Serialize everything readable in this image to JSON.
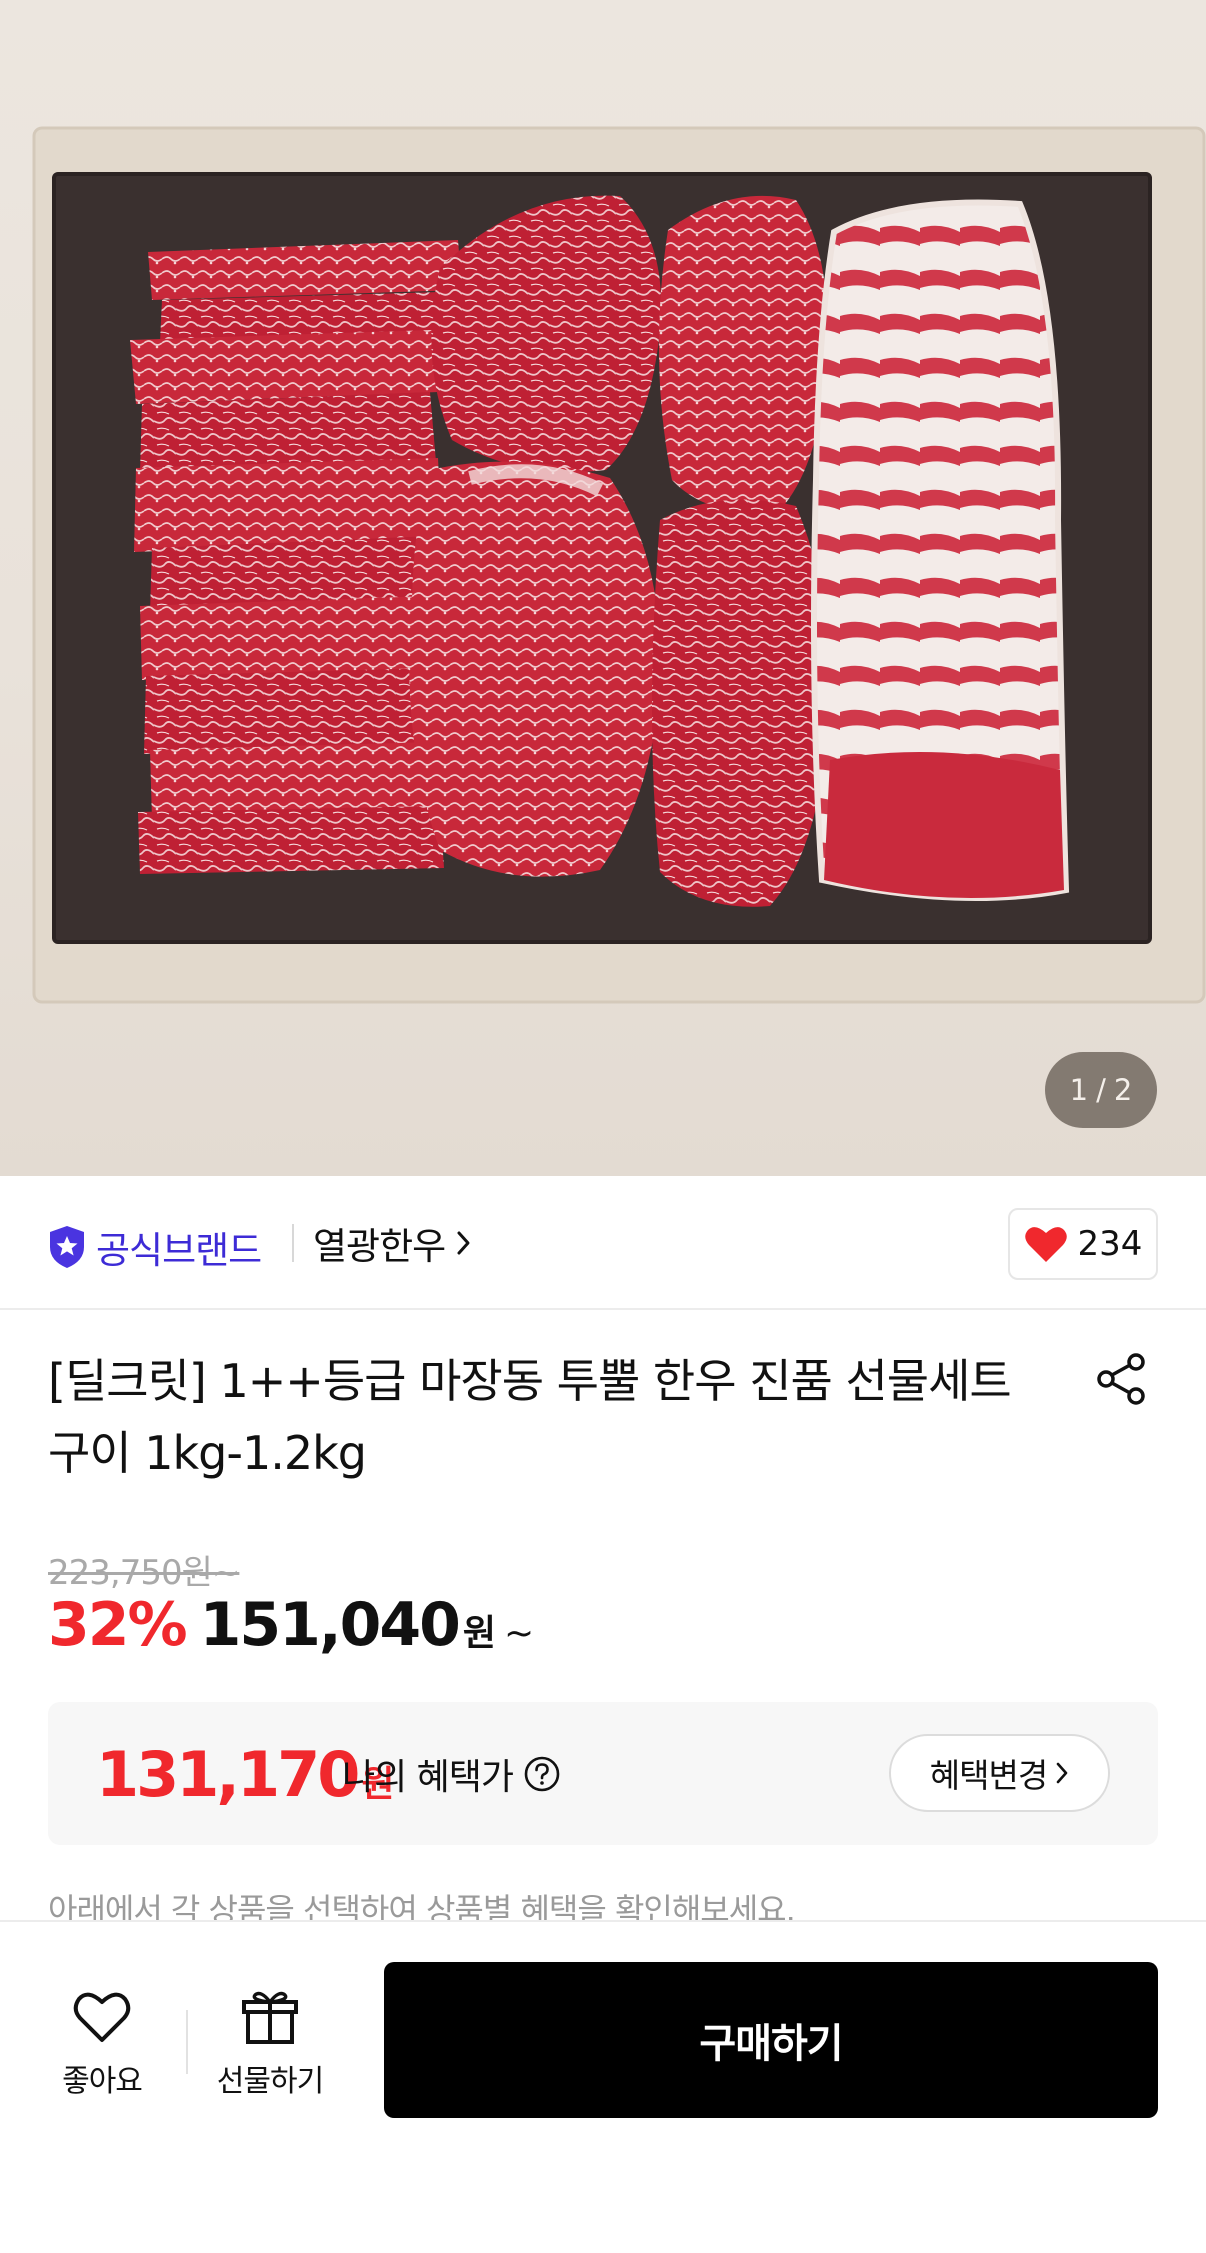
{
  "gallery": {
    "current_page": "1",
    "separator": "/",
    "total_pages": "2"
  },
  "brand": {
    "badge_label": "공식브랜드",
    "store_name": "열광한우",
    "like_count": "234"
  },
  "product": {
    "title_line1": "[딜크릿] 1++등급 마장동 투뿔 한우 진품 선물세트",
    "title_line2": "구이 1kg-1.2kg",
    "original_price": "223,750원~",
    "discount_rate": "32%",
    "sale_price": "151,040",
    "currency": "원",
    "price_suffix": "~"
  },
  "benefit": {
    "price": "131,170",
    "currency": "원",
    "label": "나의 혜택가",
    "change_button": "혜택변경"
  },
  "hint_text": "아래에서 각 상품을 선택하여 상품별 혜택을 확인해보세요.",
  "bottom_bar": {
    "like_label": "좋아요",
    "gift_label": "선물하기",
    "buy_label": "구매하기"
  },
  "colors": {
    "brand_accent": "#3d2bd6",
    "discount_red": "#f0282d",
    "buy_button": "#000000"
  }
}
